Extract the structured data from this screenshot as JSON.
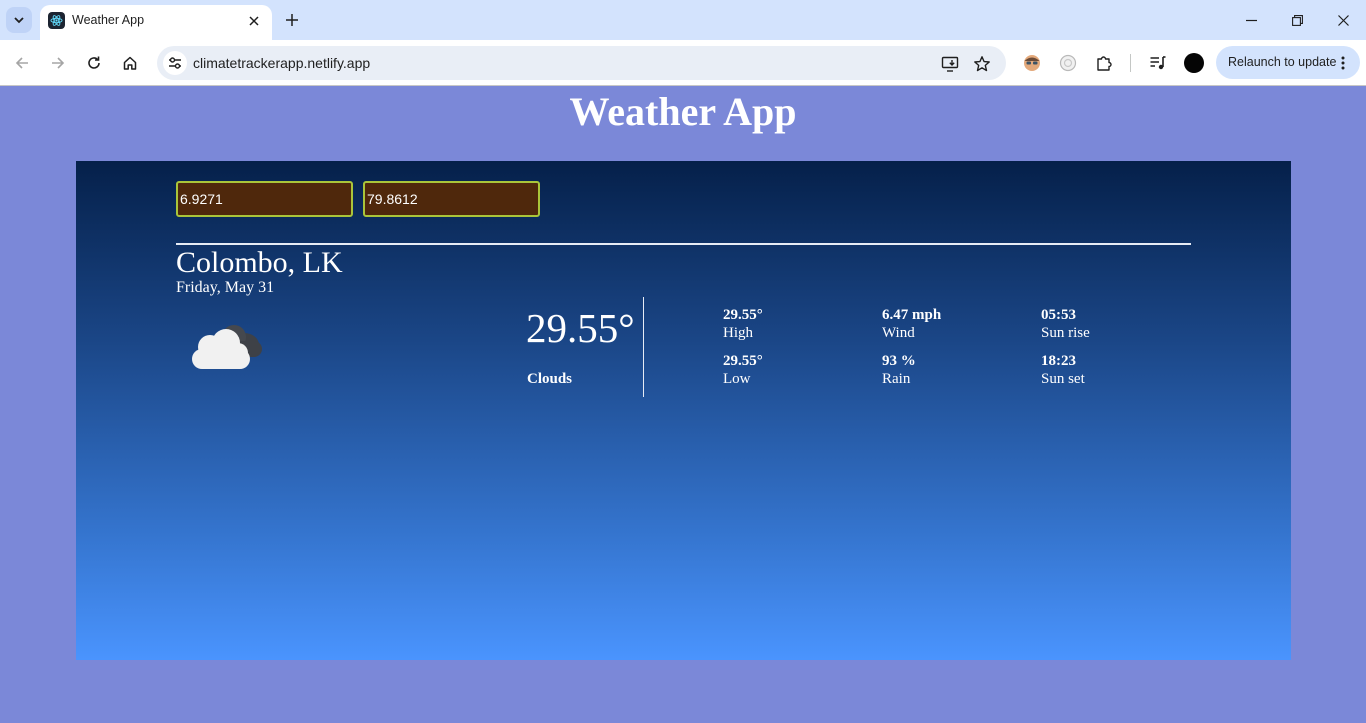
{
  "browser": {
    "tab": {
      "title": "Weather App"
    },
    "url": "climatetrackerapp.netlify.app",
    "relaunch_label": "Relaunch to update"
  },
  "page": {
    "title": "Weather App",
    "inputs": {
      "latitude": "6.9271",
      "longitude": "79.8612"
    },
    "location": "Colombo, LK",
    "date": "Friday, May 31",
    "icon": "cloud-icon",
    "temperature": "29.55°",
    "condition": "Clouds",
    "stats": {
      "high": {
        "value": "29.55°",
        "label": "High"
      },
      "low": {
        "value": "29.55°",
        "label": "Low"
      },
      "wind": {
        "value": "6.47 mph",
        "label": "Wind"
      },
      "rain": {
        "value": "93 %",
        "label": "Rain"
      },
      "sunrise": {
        "value": "05:53",
        "label": "Sun rise"
      },
      "sunset": {
        "value": "18:23",
        "label": "Sun set"
      }
    }
  },
  "colors": {
    "page_background": "#7b88d8",
    "panel_top": "#05204a",
    "panel_bottom": "#4a94fe",
    "input_background": "#4f280c",
    "input_border": "#aac53a"
  }
}
